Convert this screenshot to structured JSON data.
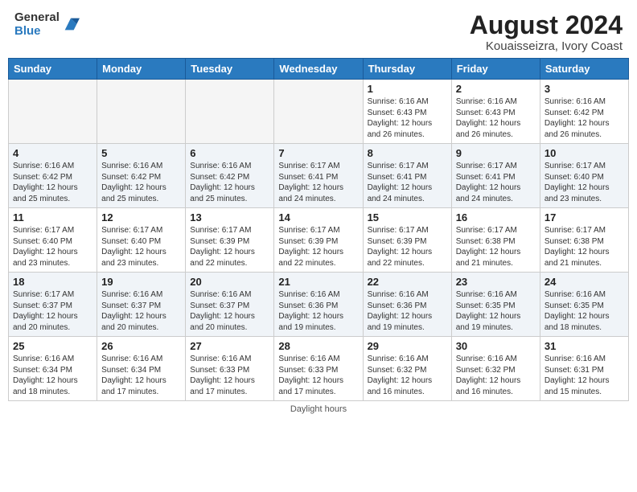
{
  "header": {
    "logo_line1": "General",
    "logo_line2": "Blue",
    "title": "August 2024",
    "subtitle": "Kouaisseizra, Ivory Coast"
  },
  "days_of_week": [
    "Sunday",
    "Monday",
    "Tuesday",
    "Wednesday",
    "Thursday",
    "Friday",
    "Saturday"
  ],
  "weeks": [
    [
      {
        "day": "",
        "info": ""
      },
      {
        "day": "",
        "info": ""
      },
      {
        "day": "",
        "info": ""
      },
      {
        "day": "",
        "info": ""
      },
      {
        "day": "1",
        "info": "Sunrise: 6:16 AM\nSunset: 6:43 PM\nDaylight: 12 hours\nand 26 minutes."
      },
      {
        "day": "2",
        "info": "Sunrise: 6:16 AM\nSunset: 6:43 PM\nDaylight: 12 hours\nand 26 minutes."
      },
      {
        "day": "3",
        "info": "Sunrise: 6:16 AM\nSunset: 6:42 PM\nDaylight: 12 hours\nand 26 minutes."
      }
    ],
    [
      {
        "day": "4",
        "info": "Sunrise: 6:16 AM\nSunset: 6:42 PM\nDaylight: 12 hours\nand 25 minutes."
      },
      {
        "day": "5",
        "info": "Sunrise: 6:16 AM\nSunset: 6:42 PM\nDaylight: 12 hours\nand 25 minutes."
      },
      {
        "day": "6",
        "info": "Sunrise: 6:16 AM\nSunset: 6:42 PM\nDaylight: 12 hours\nand 25 minutes."
      },
      {
        "day": "7",
        "info": "Sunrise: 6:17 AM\nSunset: 6:41 PM\nDaylight: 12 hours\nand 24 minutes."
      },
      {
        "day": "8",
        "info": "Sunrise: 6:17 AM\nSunset: 6:41 PM\nDaylight: 12 hours\nand 24 minutes."
      },
      {
        "day": "9",
        "info": "Sunrise: 6:17 AM\nSunset: 6:41 PM\nDaylight: 12 hours\nand 24 minutes."
      },
      {
        "day": "10",
        "info": "Sunrise: 6:17 AM\nSunset: 6:40 PM\nDaylight: 12 hours\nand 23 minutes."
      }
    ],
    [
      {
        "day": "11",
        "info": "Sunrise: 6:17 AM\nSunset: 6:40 PM\nDaylight: 12 hours\nand 23 minutes."
      },
      {
        "day": "12",
        "info": "Sunrise: 6:17 AM\nSunset: 6:40 PM\nDaylight: 12 hours\nand 23 minutes."
      },
      {
        "day": "13",
        "info": "Sunrise: 6:17 AM\nSunset: 6:39 PM\nDaylight: 12 hours\nand 22 minutes."
      },
      {
        "day": "14",
        "info": "Sunrise: 6:17 AM\nSunset: 6:39 PM\nDaylight: 12 hours\nand 22 minutes."
      },
      {
        "day": "15",
        "info": "Sunrise: 6:17 AM\nSunset: 6:39 PM\nDaylight: 12 hours\nand 22 minutes."
      },
      {
        "day": "16",
        "info": "Sunrise: 6:17 AM\nSunset: 6:38 PM\nDaylight: 12 hours\nand 21 minutes."
      },
      {
        "day": "17",
        "info": "Sunrise: 6:17 AM\nSunset: 6:38 PM\nDaylight: 12 hours\nand 21 minutes."
      }
    ],
    [
      {
        "day": "18",
        "info": "Sunrise: 6:17 AM\nSunset: 6:37 PM\nDaylight: 12 hours\nand 20 minutes."
      },
      {
        "day": "19",
        "info": "Sunrise: 6:16 AM\nSunset: 6:37 PM\nDaylight: 12 hours\nand 20 minutes."
      },
      {
        "day": "20",
        "info": "Sunrise: 6:16 AM\nSunset: 6:37 PM\nDaylight: 12 hours\nand 20 minutes."
      },
      {
        "day": "21",
        "info": "Sunrise: 6:16 AM\nSunset: 6:36 PM\nDaylight: 12 hours\nand 19 minutes."
      },
      {
        "day": "22",
        "info": "Sunrise: 6:16 AM\nSunset: 6:36 PM\nDaylight: 12 hours\nand 19 minutes."
      },
      {
        "day": "23",
        "info": "Sunrise: 6:16 AM\nSunset: 6:35 PM\nDaylight: 12 hours\nand 19 minutes."
      },
      {
        "day": "24",
        "info": "Sunrise: 6:16 AM\nSunset: 6:35 PM\nDaylight: 12 hours\nand 18 minutes."
      }
    ],
    [
      {
        "day": "25",
        "info": "Sunrise: 6:16 AM\nSunset: 6:34 PM\nDaylight: 12 hours\nand 18 minutes."
      },
      {
        "day": "26",
        "info": "Sunrise: 6:16 AM\nSunset: 6:34 PM\nDaylight: 12 hours\nand 17 minutes."
      },
      {
        "day": "27",
        "info": "Sunrise: 6:16 AM\nSunset: 6:33 PM\nDaylight: 12 hours\nand 17 minutes."
      },
      {
        "day": "28",
        "info": "Sunrise: 6:16 AM\nSunset: 6:33 PM\nDaylight: 12 hours\nand 17 minutes."
      },
      {
        "day": "29",
        "info": "Sunrise: 6:16 AM\nSunset: 6:32 PM\nDaylight: 12 hours\nand 16 minutes."
      },
      {
        "day": "30",
        "info": "Sunrise: 6:16 AM\nSunset: 6:32 PM\nDaylight: 12 hours\nand 16 minutes."
      },
      {
        "day": "31",
        "info": "Sunrise: 6:16 AM\nSunset: 6:31 PM\nDaylight: 12 hours\nand 15 minutes."
      }
    ]
  ],
  "footer": "Daylight hours"
}
